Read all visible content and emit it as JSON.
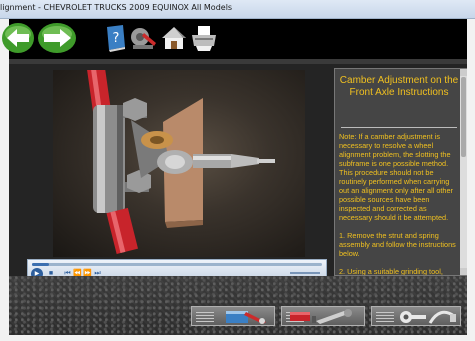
{
  "window": {
    "title": "lignment - CHEVROLET TRUCKS 2009 EQUINOX All Models"
  },
  "toolbar": {
    "back_icon": "left-arrow-icon",
    "forward_icon": "right-arrow-icon",
    "tools": [
      "help-book-icon",
      "tools-icon",
      "home-icon",
      "print-icon"
    ]
  },
  "instructions": {
    "title": "Camber Adjustment on the Front Axle Instructions",
    "paragraphs": [
      "Note: If a camber adjustment is necessary to resolve a wheel alignment problem, the slotting the subframe is one possible method. This procedure should not be routinely performed when carrying out an alignment only after all other possible sources have been inspected and corrected as necessary should it be attempted.",
      "1. Remove the strut and spring assembly and follow the instructions below.",
      "2. Using a suitable grinding tool,"
    ]
  },
  "player": {
    "progress": 0.06,
    "controls": [
      "play",
      "stop",
      "previous",
      "rewind",
      "fast-forward",
      "next"
    ]
  },
  "colors": {
    "instruction_text": "#f0c020",
    "app_background": "#000000"
  }
}
